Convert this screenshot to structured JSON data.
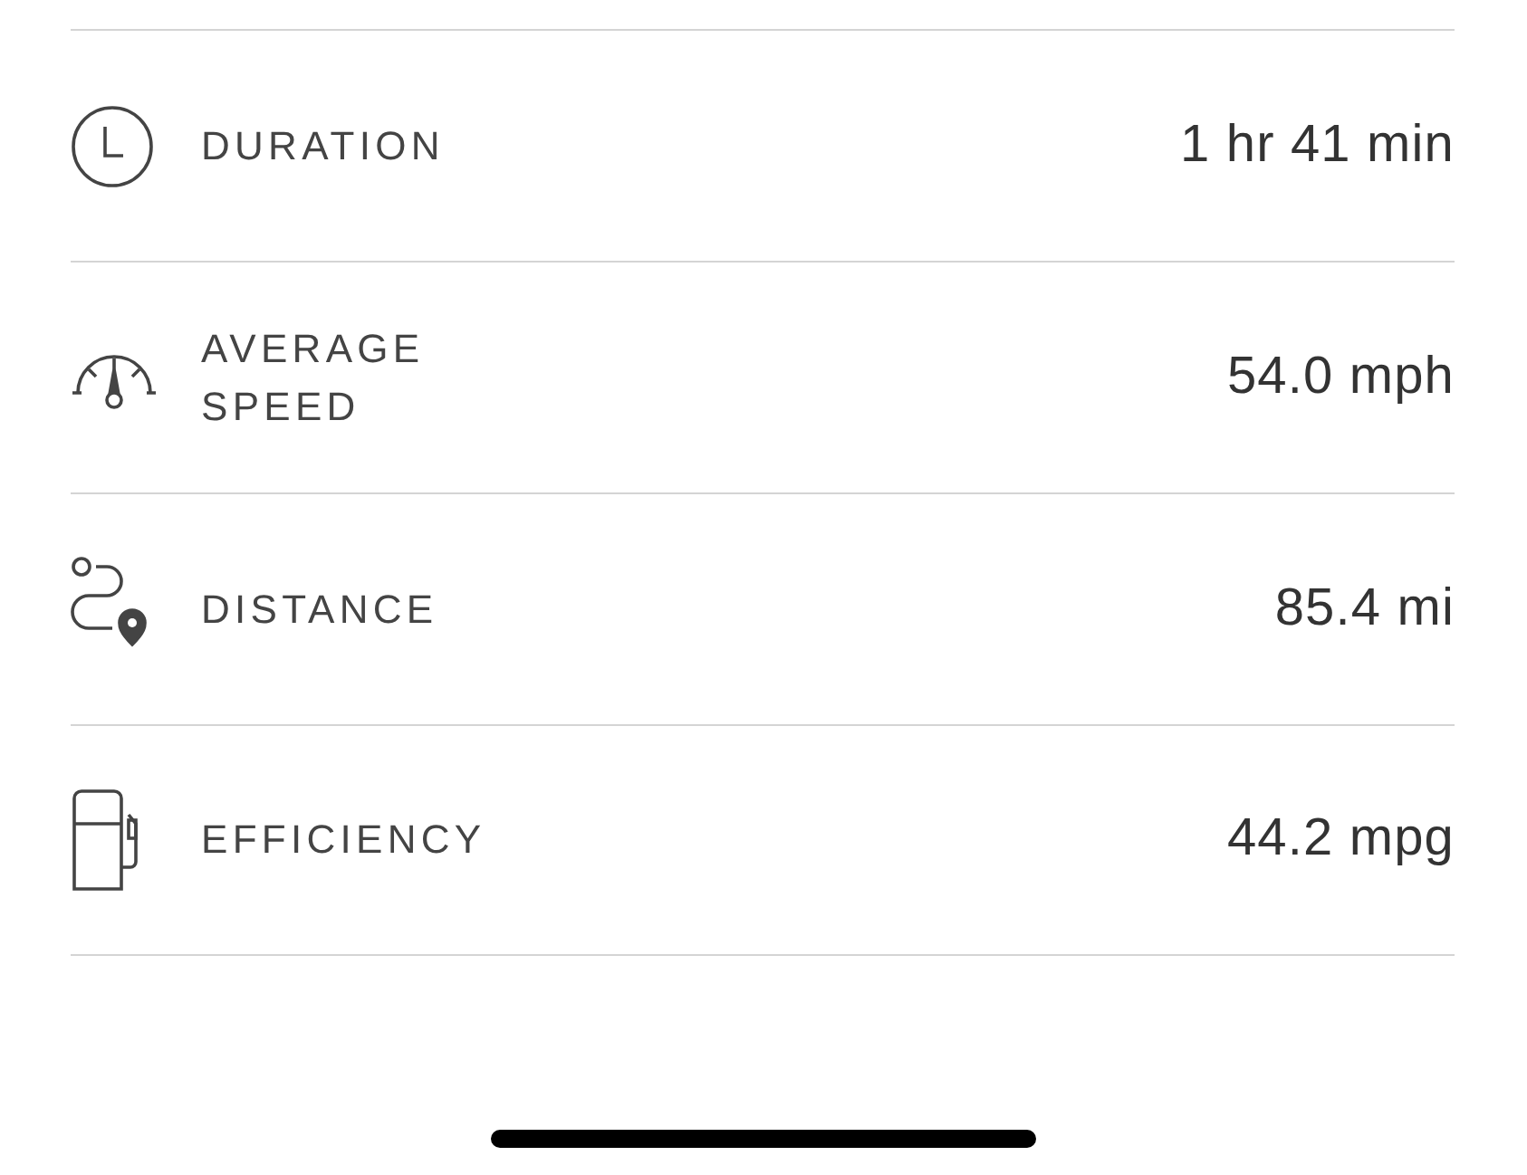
{
  "stats": [
    {
      "kind": "duration",
      "label": "DURATION",
      "value": "1 hr 41 min"
    },
    {
      "kind": "speed",
      "label": "AVERAGE\nSPEED",
      "value": "54.0 mph"
    },
    {
      "kind": "distance",
      "label": "DISTANCE",
      "value": "85.4 mi"
    },
    {
      "kind": "efficiency",
      "label": "EFFICIENCY",
      "value": "44.2 mpg"
    }
  ]
}
